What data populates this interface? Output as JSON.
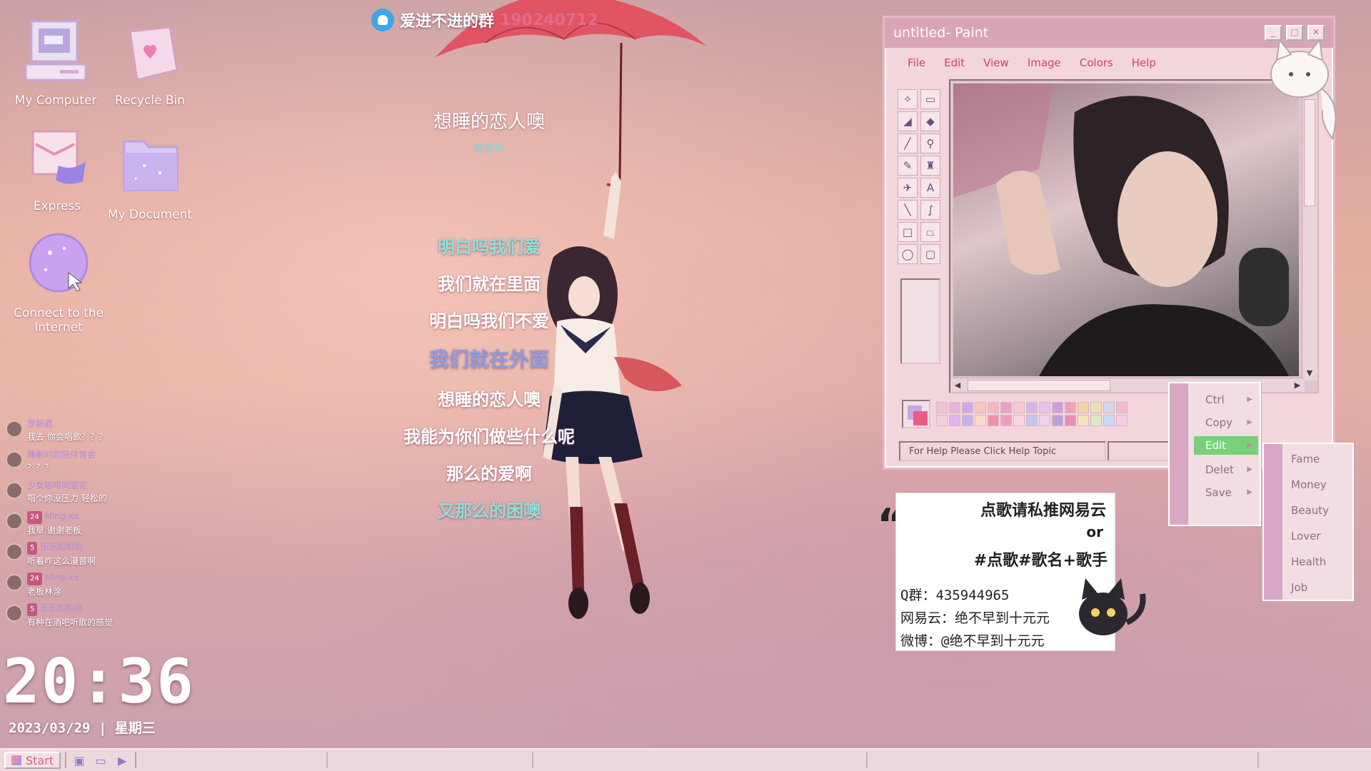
{
  "desktop": {
    "icons": [
      {
        "label": "My Computer"
      },
      {
        "label": "Recycle Bin"
      },
      {
        "label": "Express"
      },
      {
        "label": "My Document"
      },
      {
        "label": "Connect to the Internet"
      }
    ]
  },
  "banner": {
    "text": "爱进不进的群",
    "number": "190240712"
  },
  "song": {
    "title": "想睡的恋人噢",
    "artist": "杨丞琳",
    "lyrics": [
      {
        "text": "明白吗我们爱",
        "color": "#8ee0d8"
      },
      {
        "text": "我们就在里面",
        "color": "#ffffff"
      },
      {
        "text": "明白吗我们不爱",
        "color": "#ffffff"
      },
      {
        "text": "我们就在外面",
        "color": "#8c9de0"
      },
      {
        "text": "想睡的恋人噢",
        "color": "#ffffff"
      },
      {
        "text": "我能为你们做些什么呢",
        "color": "#ffffff"
      },
      {
        "text": "那么的爱啊",
        "color": "#ffffff"
      },
      {
        "text": "又那么的困噢",
        "color": "#8ee0d8"
      }
    ]
  },
  "chat": {
    "messages": [
      {
        "badge": "",
        "name": "罗新君",
        "text": "我去 你会唱歌？？？"
      },
      {
        "badge": "",
        "name": "睡眠时的陪伴曾会",
        "text": "？？？"
      },
      {
        "badge": "",
        "name": "少女咖啡同堂花",
        "text": "唱个你没压力 轻松的"
      },
      {
        "badge": "24",
        "name": "Mlng-xx",
        "text": "我草 谢谢老板"
      },
      {
        "badge": "5",
        "name": "乐乐的柏尚",
        "text": "听着咋这么漫普啊"
      },
      {
        "badge": "24",
        "name": "Mlng-xx",
        "text": "老板林涂"
      },
      {
        "badge": "5",
        "name": "乐乐的柏尚",
        "text": "有种在酒吧听歌的感觉"
      }
    ]
  },
  "clock": {
    "time": "20:36",
    "date": "2023/03/29 | 星期三"
  },
  "taskbar": {
    "start_label": "Start"
  },
  "paint": {
    "title": "untitled- Paint",
    "menus": [
      "File",
      "Edit",
      "View",
      "Image",
      "Colors",
      "Help"
    ],
    "status": "For Help Please Click Help Topic",
    "swatch_colors": [
      "#f0c2d2",
      "#e6b3dc",
      "#cfa8e8",
      "#f4c9b8",
      "#f6b7c0",
      "#e7a3c7",
      "#f3c9d6",
      "#d7b7e9",
      "#e5c4e6",
      "#c9a0d8",
      "#f0a0b8",
      "#eed3a8",
      "#e9e1b2",
      "#d1d7f0",
      "#f1b9cf",
      "#f4d0dc",
      "#dcb6ec",
      "#c3b3ea",
      "#f8dac5",
      "#ef8fa8",
      "#ef9cbe",
      "#f8d7e4",
      "#c1c7ef",
      "#efd0ec",
      "#b7a2db",
      "#e88eb1",
      "#f3e3bb",
      "#dde8c4",
      "#c4dcf2",
      "#f6cde0"
    ]
  },
  "context_menu": {
    "items": [
      "Ctrl",
      "Copy",
      "Edit",
      "Delet",
      "Save"
    ],
    "active": "Edit",
    "submenu": [
      "Fame",
      "Money",
      "Beauty",
      "Lover",
      "Health",
      "Job"
    ]
  },
  "note": {
    "line_a": "点歌请私推网易云",
    "line_b": "or",
    "line_c": "#点歌#歌名+歌手",
    "qq": "Q群：435944965",
    "netease": "网易云：绝不早到十元元",
    "weibo": "微博：@绝不早到十元元"
  }
}
